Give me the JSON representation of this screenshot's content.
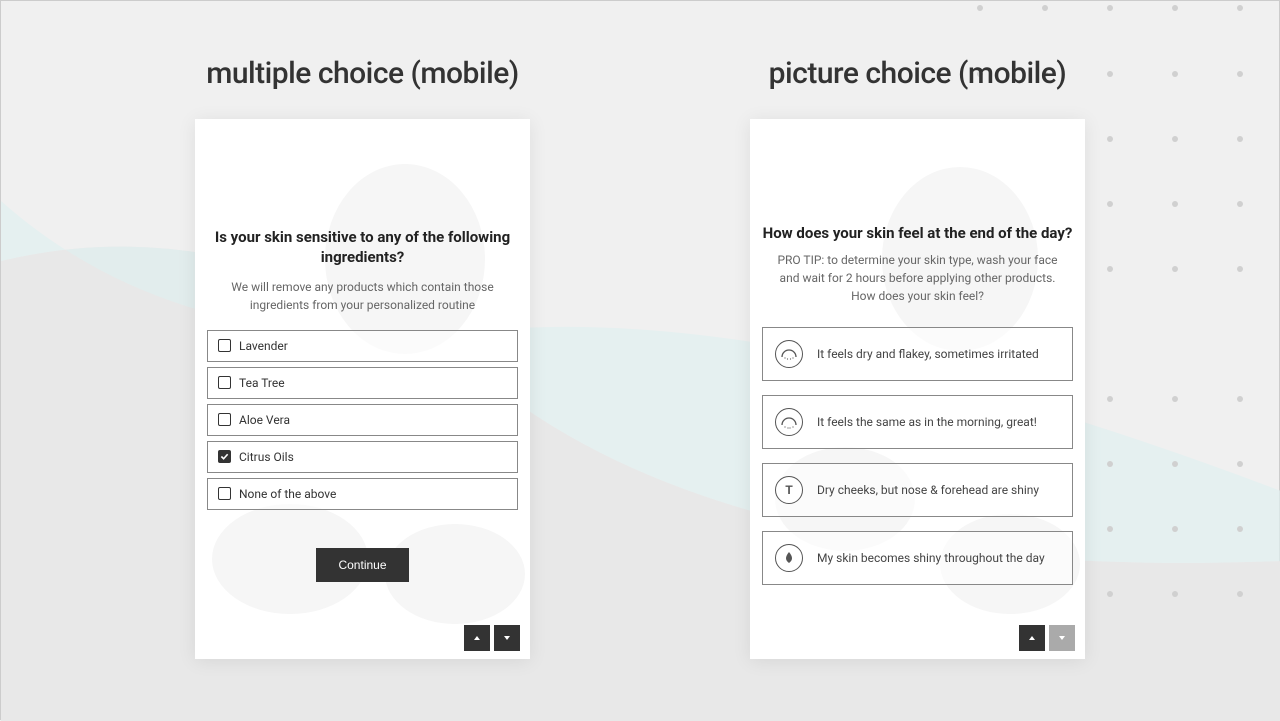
{
  "left": {
    "title": "multiple choice (mobile)",
    "question": "Is your skin sensitive to any of the following ingredients?",
    "subtext": "We will remove any products which contain those ingredients from your personalized routine",
    "options": [
      {
        "label": "Lavender",
        "checked": false
      },
      {
        "label": "Tea Tree",
        "checked": false
      },
      {
        "label": "Aloe Vera",
        "checked": false
      },
      {
        "label": "Citrus Oils",
        "checked": true
      },
      {
        "label": "None of the above",
        "checked": false
      }
    ],
    "continue_label": "Continue"
  },
  "right": {
    "title": "picture choice (mobile)",
    "question": "How does your skin feel at the end of the day?",
    "subtext": "PRO TIP: to determine your skin type, wash your face and wait for 2 hours before applying other products. How does your skin feel?",
    "options": [
      {
        "label": "It feels dry and flakey, sometimes irritated",
        "icon": "dry"
      },
      {
        "label": "It feels the same as in the morning, great!",
        "icon": "normal"
      },
      {
        "label": "Dry cheeks, but nose & forehead are shiny",
        "icon": "combo"
      },
      {
        "label": "My skin becomes shiny throughout the day",
        "icon": "oily"
      }
    ]
  }
}
